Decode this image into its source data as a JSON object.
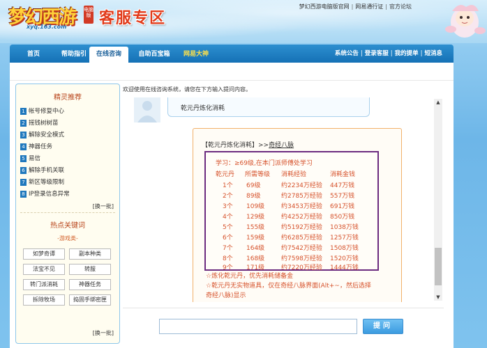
{
  "header": {
    "logo_text": "梦幻西游",
    "logo_badge": "电脑版",
    "logo_url": "xyq.163.com",
    "title": "客服专区",
    "top_links": [
      "梦幻西游电脑版官网",
      "网易通行证",
      "官方论坛"
    ]
  },
  "nav": {
    "tabs": [
      {
        "label": "首页"
      },
      {
        "label": "帮助指引"
      },
      {
        "label": "在线咨询",
        "active": true
      },
      {
        "label": "自助百宝箱"
      },
      {
        "label": "网易大神"
      }
    ],
    "right_links": [
      "系统公告",
      "登录客服",
      "我的提单",
      "短消息"
    ]
  },
  "sidebar": {
    "title": "精灵推荐",
    "items": [
      {
        "num": "1",
        "label": "帐号修复中心"
      },
      {
        "num": "2",
        "label": "摇钱树树苗"
      },
      {
        "num": "3",
        "label": "解除安全模式"
      },
      {
        "num": "4",
        "label": "神器任务"
      },
      {
        "num": "5",
        "label": "易信"
      },
      {
        "num": "6",
        "label": "解除手机关联"
      },
      {
        "num": "7",
        "label": "新区等级限制"
      },
      {
        "num": "8",
        "label": "IP登录信息异常"
      }
    ],
    "more_label": "[换一批]",
    "keywords_title": "热点关键词",
    "keywords_sub": "-游戏类-",
    "keywords": [
      "如梦奇谭",
      "副本种类",
      "法宝不见",
      "转服",
      "转门派消耗",
      "神器任务",
      "拆除牧场",
      "捣固手绑密匣"
    ],
    "more_label_2": "[换一批]"
  },
  "chat": {
    "welcome": "欢迎使用在线咨询系统，请您在下方输入提问内容。",
    "user_question": "乾元丹炼化消耗",
    "reply_title_prefix": "【乾元丹炼化消耗】>>",
    "reply_title_link": "奇经八脉",
    "requirement": "学习：≥69级,在本门派师傅处学习",
    "table_headers": [
      "乾元丹",
      "所需等级",
      "消耗经验",
      "消耗金钱"
    ],
    "table_rows": [
      [
        "1个",
        "69级",
        "约2234万经验",
        "447万钱"
      ],
      [
        "2个",
        "89级",
        "约2785万经验",
        "557万钱"
      ],
      [
        "3个",
        "109级",
        "约3453万经验",
        "691万钱"
      ],
      [
        "4个",
        "129级",
        "约4252万经验",
        "850万钱"
      ],
      [
        "5个",
        "155级",
        "约5192万经验",
        "1038万钱"
      ],
      [
        "6个",
        "159级",
        "约6285万经验",
        "1257万钱"
      ],
      [
        "7个",
        "164级",
        "约7542万经验",
        "1508万钱"
      ],
      [
        "8个",
        "168级",
        "约7598万经验",
        "1520万钱"
      ],
      [
        "9个",
        "171级",
        "约7220万经验",
        "1444万钱"
      ]
    ],
    "notes": [
      "☆炼化乾元丹，优先消耗储备金",
      "☆乾元丹无实物道具，仅在奇经八脉界面(Alt+~，然后选择",
      "奇经八脉)显示"
    ]
  },
  "input": {
    "value": "",
    "placeholder": "",
    "ask_label": "提问"
  },
  "colors": {
    "nav_blue": "#1a7dc4",
    "accent_orange": "#d6512a",
    "box_purple": "#6b2a7f",
    "title_red": "#e23a1a"
  }
}
